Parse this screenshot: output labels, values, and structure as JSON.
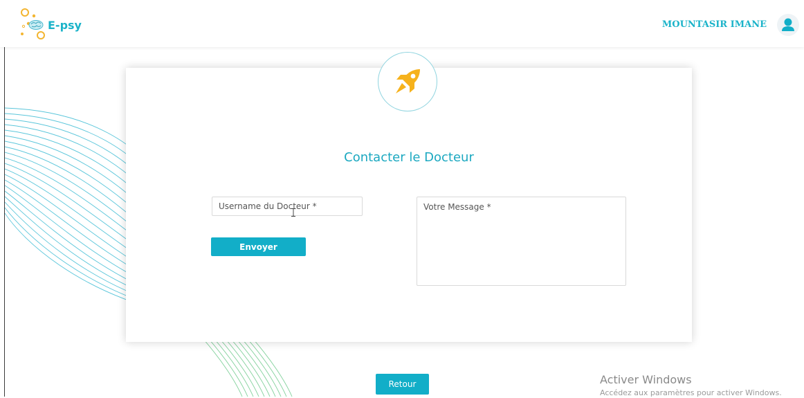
{
  "app": {
    "brand": "E-psy"
  },
  "header": {
    "user_name": "MOUNTASIR IMANE"
  },
  "form": {
    "title": "Contacter le Docteur",
    "username_placeholder": "Username du Docteur *",
    "username_value": "",
    "message_placeholder": "Votre Message *",
    "message_value": "",
    "send_label": "Envoyer"
  },
  "footer": {
    "back_label": "Retour"
  },
  "watermark": {
    "title": "Activer Windows",
    "subtitle": "Accédez aux paramètres pour activer Windows."
  },
  "icons": {
    "logo": "brain-network-logo-icon",
    "avatar": "user-avatar-icon",
    "rocket": "rocket-icon"
  },
  "colors": {
    "accent": "#12aec8",
    "brand_text": "#1bb3c9",
    "rocket": "#f6b21c",
    "logo_circles": "#f3b530",
    "waves": "#3dbcd4"
  }
}
